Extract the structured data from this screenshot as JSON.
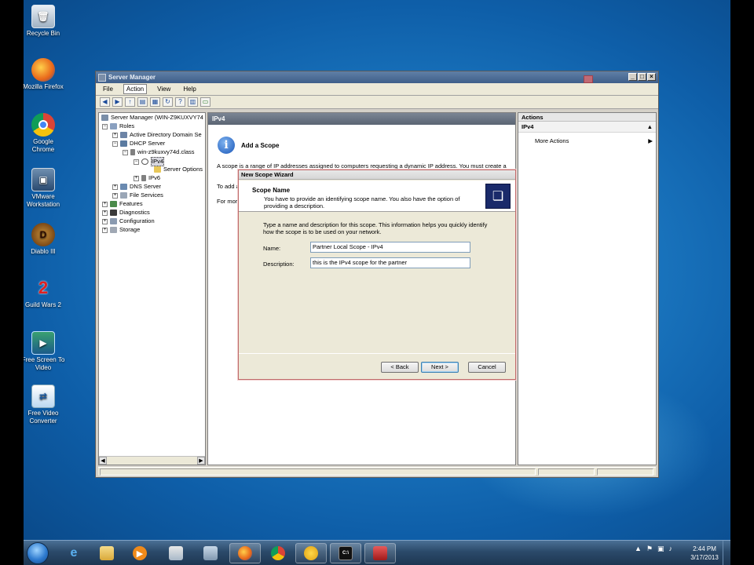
{
  "desktop": {
    "icons": [
      {
        "label": "Recycle Bin"
      },
      {
        "label": "Mozilla Firefox"
      },
      {
        "label": "Google Chrome"
      },
      {
        "label": "VMware Workstation"
      },
      {
        "label": "Diablo III"
      },
      {
        "label": "Guild Wars 2"
      },
      {
        "label": "Free Screen To Video"
      },
      {
        "label": "Free Video Converter"
      }
    ]
  },
  "server_manager": {
    "title": "Server Manager",
    "menu": [
      "File",
      "Action",
      "View",
      "Help"
    ],
    "tree": [
      {
        "label": "Server Manager (WIN-Z9KUXVY74"
      },
      {
        "label": "Roles"
      },
      {
        "label": "Active Directory Domain Se"
      },
      {
        "label": "DHCP Server"
      },
      {
        "label": "win-z9kuxvy74d.class"
      },
      {
        "label": "IPv4"
      },
      {
        "label": "Server Options"
      },
      {
        "label": "IPv6"
      },
      {
        "label": "DNS Server"
      },
      {
        "label": "File Services"
      },
      {
        "label": "Features"
      },
      {
        "label": "Diagnostics"
      },
      {
        "label": "Configuration"
      },
      {
        "label": "Storage"
      }
    ],
    "center": {
      "header": "IPv4",
      "add_scope_title": "Add a Scope",
      "text_1": "A scope is a range of IP addresses assigned to computers requesting a dynamic IP address. You must create a",
      "text_2": "To add a",
      "text_3": "For more"
    },
    "actions": {
      "header": "Actions",
      "section": "IPv4",
      "more_actions": "More Actions"
    }
  },
  "wizard": {
    "title": "New Scope Wizard",
    "header_title": "Scope Name",
    "header_subtitle": "You have to provide an identifying scope name. You also have the option of providing a description.",
    "body_text": "Type a name and description for this scope. This information helps you quickly identify how the scope is to be used on your network.",
    "name_label": "Name:",
    "name_value": "Partner Local Scope - IPv4",
    "description_label": "Description:",
    "description_value": "this is the IPv4 scope for the partner",
    "back_label": "< Back",
    "next_label": "Next >",
    "cancel_label": "Cancel"
  },
  "taskbar": {
    "time": "2:44 PM",
    "date": "3/17/2013"
  }
}
